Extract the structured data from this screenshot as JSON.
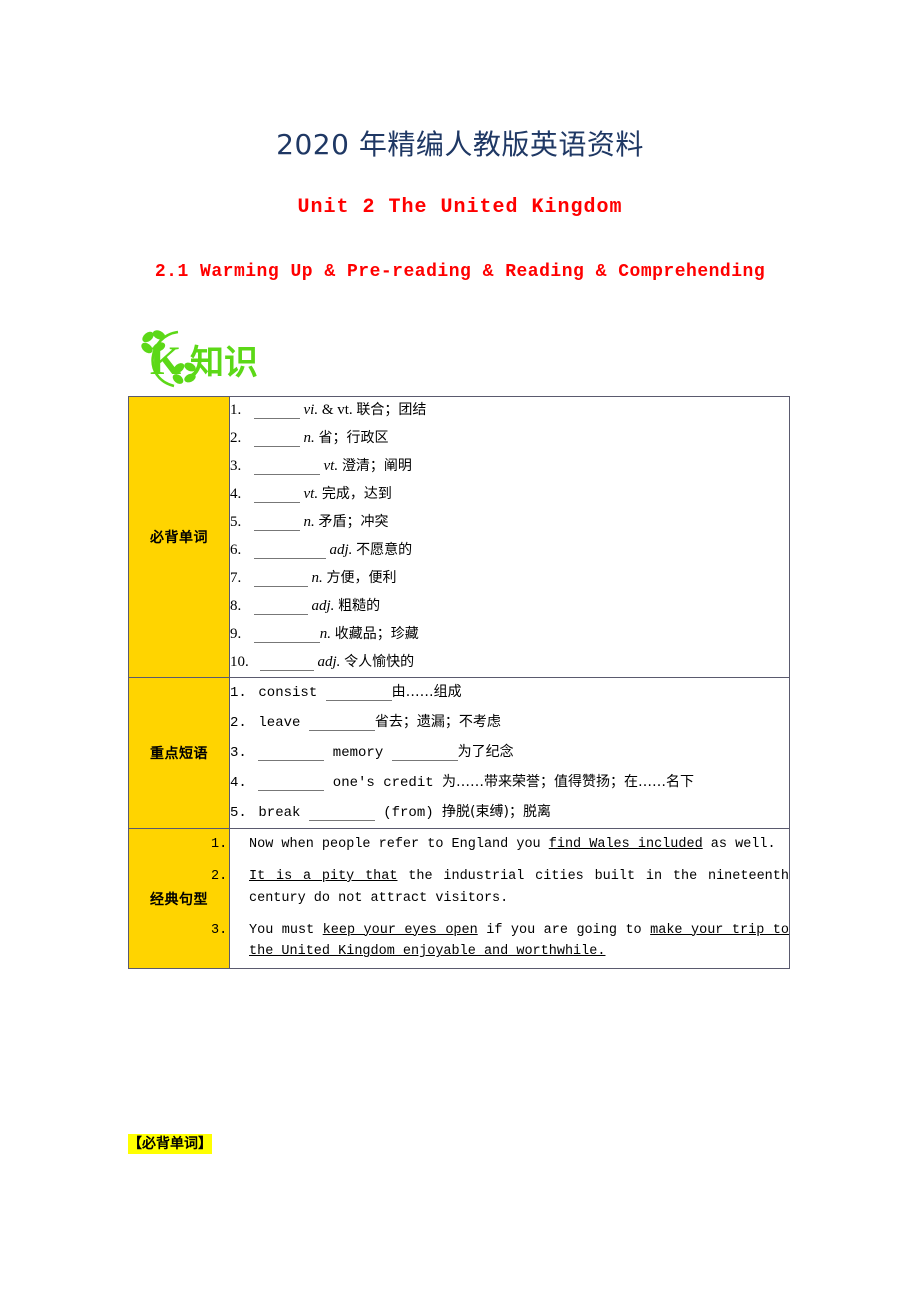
{
  "header": {
    "doc_title": "2020 年精编人教版英语资料",
    "unit_title": "Unit 2  The United Kingdom",
    "section_title": "2.1  Warming Up & Pre-reading & Reading & Comprehending",
    "title_color": "#1F3864",
    "accent_color": "#FF0000"
  },
  "logo": {
    "letter": "K",
    "text": "知识",
    "color": "#5CD817"
  },
  "table": {
    "border_color": "#5a5a6e",
    "label_bg": "#FFD400",
    "sections": [
      {
        "label": "必背单词",
        "kind": "words",
        "items": [
          {
            "num": "1.",
            "blank": "b-sm",
            "pos": "vi.",
            "pos2": "& vt.",
            "meaning": "联合；团结"
          },
          {
            "num": "2.",
            "blank": "b-sm",
            "pos": "n.",
            "pos2": "",
            "meaning": "省；行政区"
          },
          {
            "num": "3.",
            "blank": "b-lg",
            "pos": "vt.",
            "pos2": "",
            "meaning": "澄清；阐明"
          },
          {
            "num": "4.",
            "blank": "b-sm",
            "pos": "vt.",
            "pos2": "",
            "meaning": "完成，达到"
          },
          {
            "num": "5.",
            "blank": "b-sm",
            "pos": "n.",
            "pos2": "",
            "meaning": "矛盾；冲突"
          },
          {
            "num": "6.",
            "blank": "b-xl",
            "pos": "adj.",
            "pos2": "",
            "meaning": "不愿意的"
          },
          {
            "num": "7.",
            "blank": "b-md",
            "pos": "n.",
            "pos2": "",
            "meaning": "方便，便利"
          },
          {
            "num": "8.",
            "blank": "b-md",
            "pos": "adj.",
            "pos2": "",
            "meaning": "粗糙的"
          },
          {
            "num": "9.",
            "blank": "b-lg",
            "pos": "n.",
            "pos2": "",
            "meaning": "收藏品；珍藏"
          },
          {
            "num": "10.",
            "blank": "b-md",
            "pos": "adj.",
            "pos2": "",
            "meaning": "令人愉快的"
          }
        ]
      },
      {
        "label": "重点短语",
        "kind": "phrases",
        "items": [
          {
            "num": "1.",
            "pre": "consist ",
            "blank1": "b-lg",
            "mid": "",
            "blank2": "",
            "meaning": "由……组成"
          },
          {
            "num": "2.",
            "pre": "leave ",
            "blank1": "b-lg",
            "mid": "",
            "blank2": "",
            "meaning": "省去；遗漏；不考虑"
          },
          {
            "num": "3.",
            "pre": "",
            "blank1": "b-lg",
            "mid": " memory ",
            "blank2": "b-lg",
            "meaning": "为了纪念"
          },
          {
            "num": "4.",
            "pre": "",
            "blank1": "b-lg",
            "mid": " one's credit ",
            "blank2": "",
            "meaning": "为……带来荣誉；值得赞扬；在……名下"
          },
          {
            "num": "5.",
            "pre": "break ",
            "blank1": "b-lg",
            "mid": " (from) ",
            "blank2": "",
            "meaning": "挣脱(束缚)；脱离"
          }
        ]
      },
      {
        "label": "经典句型",
        "kind": "sentences",
        "items": [
          {
            "num": "1.",
            "parts": [
              {
                "t": "Now when people refer to England you ",
                "u": false
              },
              {
                "t": "find Wales included",
                "u": true
              },
              {
                "t": " as well.",
                "u": false
              }
            ]
          },
          {
            "num": "2.",
            "parts": [
              {
                "t": "It is a pity that",
                "u": true
              },
              {
                "t": " the industrial cities built in the nineteenth century do not attract visitors.",
                "u": false
              }
            ]
          },
          {
            "num": "3.",
            "parts": [
              {
                "t": "You must ",
                "u": false
              },
              {
                "t": "keep your eyes open",
                "u": true
              },
              {
                "t": " if you are going to ",
                "u": false
              },
              {
                "t": "make your trip to the United Kingdom enjoyable and worthwhile.",
                "u": true
              }
            ]
          }
        ]
      }
    ]
  },
  "footer": {
    "label": "【必背单词】",
    "highlight": "#FFFF00"
  }
}
